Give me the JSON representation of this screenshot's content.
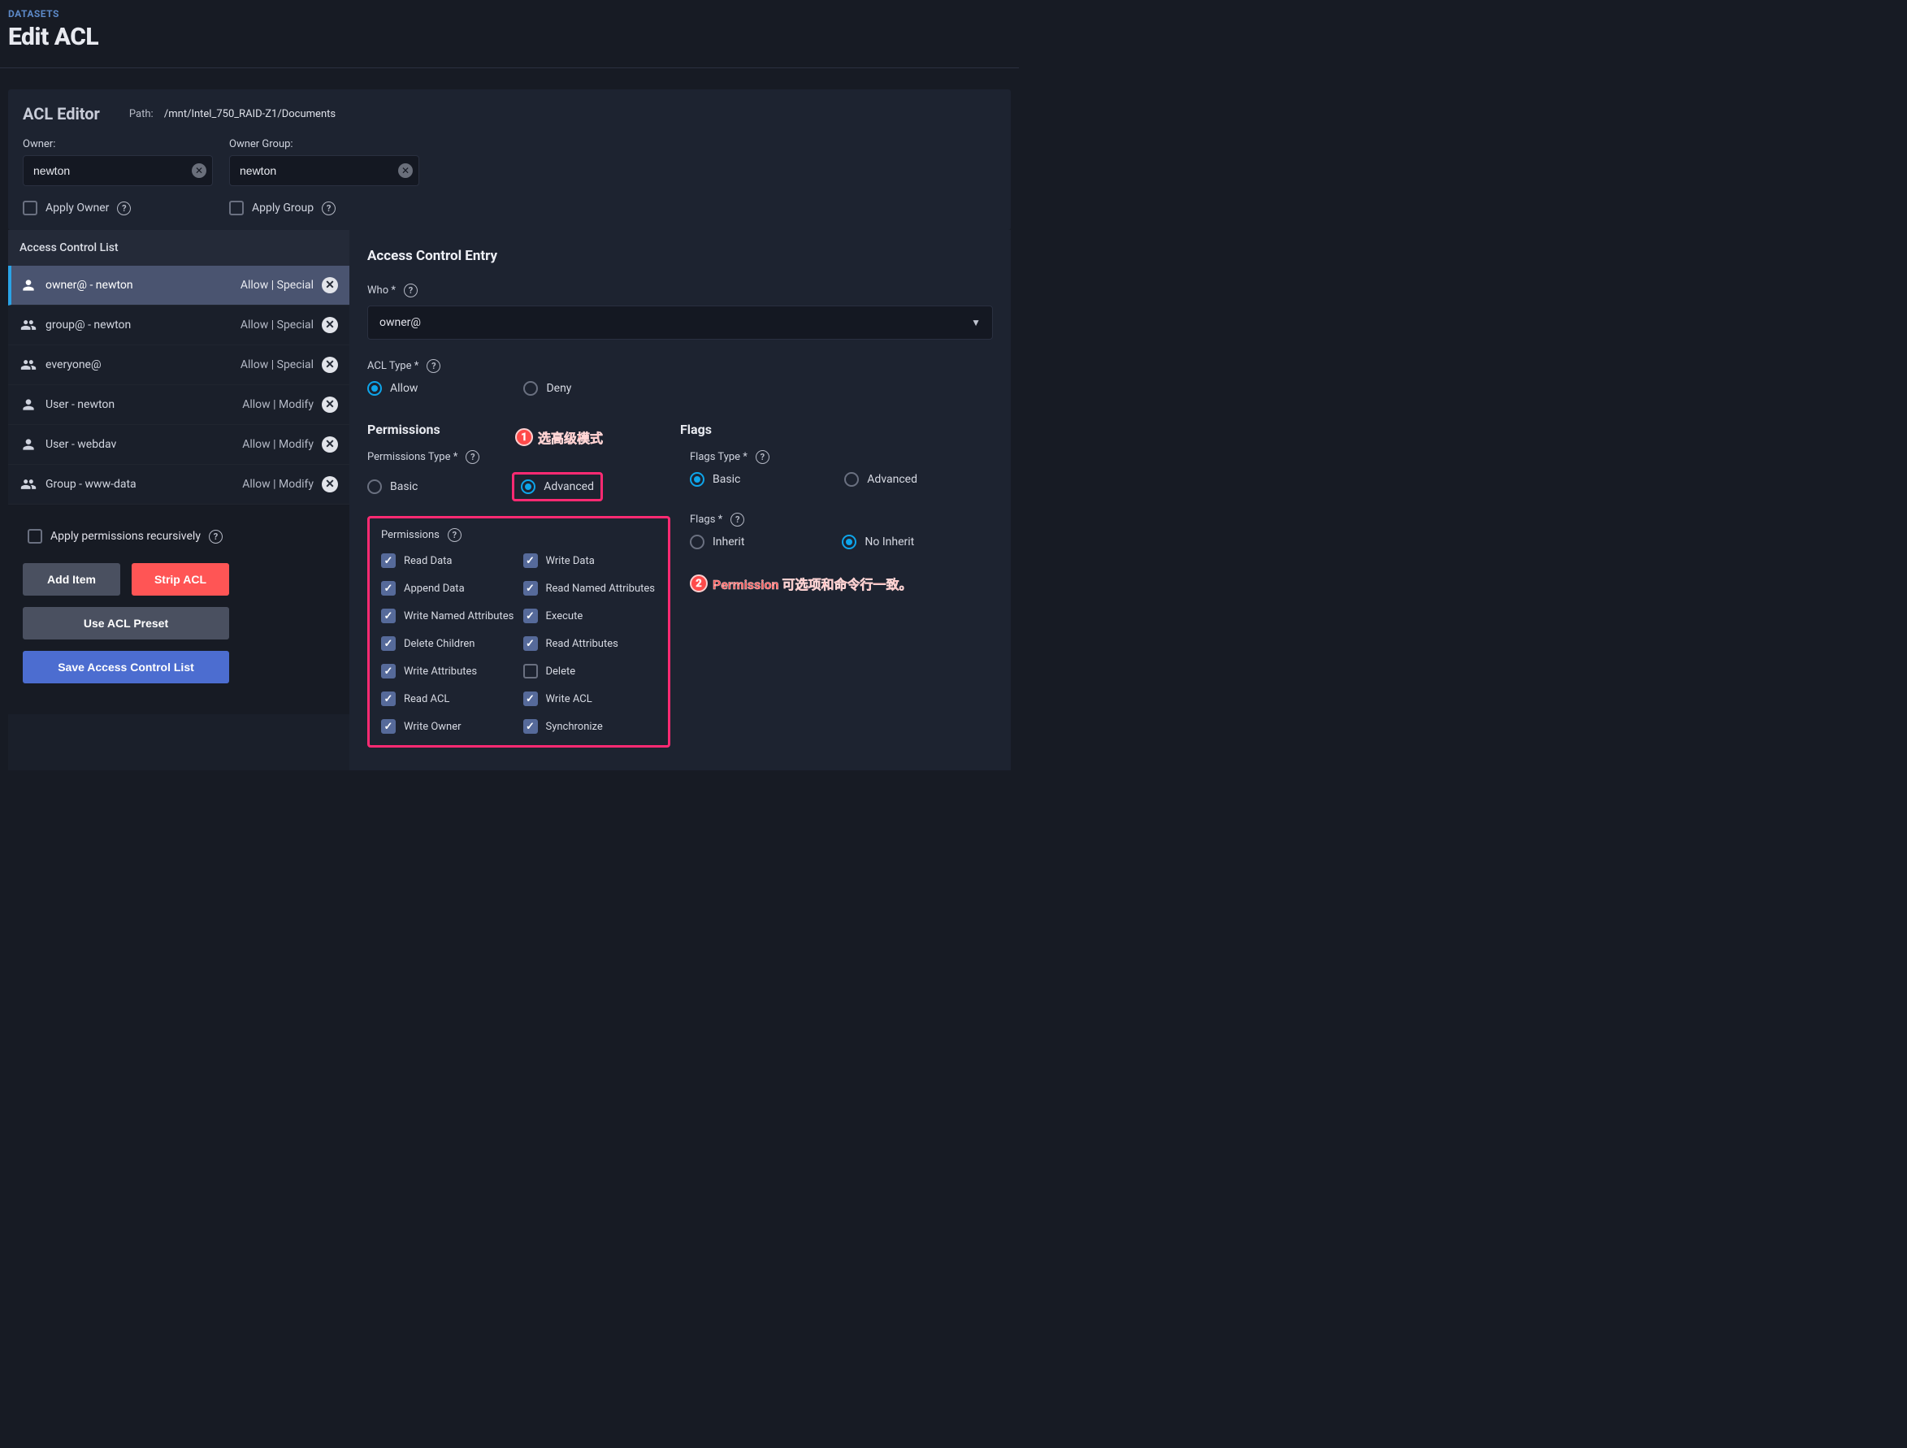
{
  "breadcrumb": "DATASETS",
  "page_title": "Edit ACL",
  "editor": {
    "title": "ACL Editor",
    "path_label": "Path:",
    "path_value": "/mnt/Intel_750_RAID-Z1/Documents",
    "owner_label": "Owner:",
    "owner_group_label": "Owner Group:",
    "owner_value": "newton",
    "owner_group_value": "newton",
    "apply_owner_label": "Apply Owner",
    "apply_group_label": "Apply Group"
  },
  "acl_list": {
    "header": "Access Control List",
    "items": [
      {
        "icon": "person",
        "label": "owner@ - newton",
        "perm": "Allow | Special",
        "selected": true
      },
      {
        "icon": "group",
        "label": "group@ - newton",
        "perm": "Allow | Special",
        "selected": false
      },
      {
        "icon": "group",
        "label": "everyone@",
        "perm": "Allow | Special",
        "selected": false
      },
      {
        "icon": "person",
        "label": "User - newton",
        "perm": "Allow | Modify",
        "selected": false
      },
      {
        "icon": "person",
        "label": "User - webdav",
        "perm": "Allow | Modify",
        "selected": false
      },
      {
        "icon": "group",
        "label": "Group - www-data",
        "perm": "Allow | Modify",
        "selected": false
      }
    ]
  },
  "bottom_controls": {
    "apply_recursive_label": "Apply permissions recursively",
    "add_item": "Add Item",
    "strip_acl": "Strip ACL",
    "use_preset": "Use ACL Preset",
    "save_acl": "Save Access Control List"
  },
  "entry": {
    "header": "Access Control Entry",
    "who_label": "Who *",
    "who_value": "owner@",
    "acl_type_label": "ACL Type *",
    "allow_label": "Allow",
    "deny_label": "Deny",
    "permissions_title": "Permissions",
    "flags_title": "Flags",
    "permissions_type_label": "Permissions Type *",
    "flags_type_label": "Flags Type *",
    "basic_label": "Basic",
    "advanced_label": "Advanced",
    "permissions_header": "Permissions",
    "flags_label2": "Flags *",
    "inherit_label": "Inherit",
    "no_inherit_label": "No Inherit",
    "perm_items": [
      {
        "label": "Read Data",
        "checked": true
      },
      {
        "label": "Write Data",
        "checked": true
      },
      {
        "label": "Append Data",
        "checked": true
      },
      {
        "label": "Read Named Attributes",
        "checked": true
      },
      {
        "label": "Write Named Attributes",
        "checked": true
      },
      {
        "label": "Execute",
        "checked": true
      },
      {
        "label": "Delete Children",
        "checked": true
      },
      {
        "label": "Read Attributes",
        "checked": true
      },
      {
        "label": "Write Attributes",
        "checked": true
      },
      {
        "label": "Delete",
        "checked": false
      },
      {
        "label": "Read ACL",
        "checked": true
      },
      {
        "label": "Write ACL",
        "checked": true
      },
      {
        "label": "Write Owner",
        "checked": true
      },
      {
        "label": "Synchronize",
        "checked": true
      }
    ]
  },
  "annotations": {
    "a1_badge": "1",
    "a1_text": "选高级模式",
    "a2_badge": "2",
    "a2_text": "Permission 可选项和命令行一致。"
  }
}
